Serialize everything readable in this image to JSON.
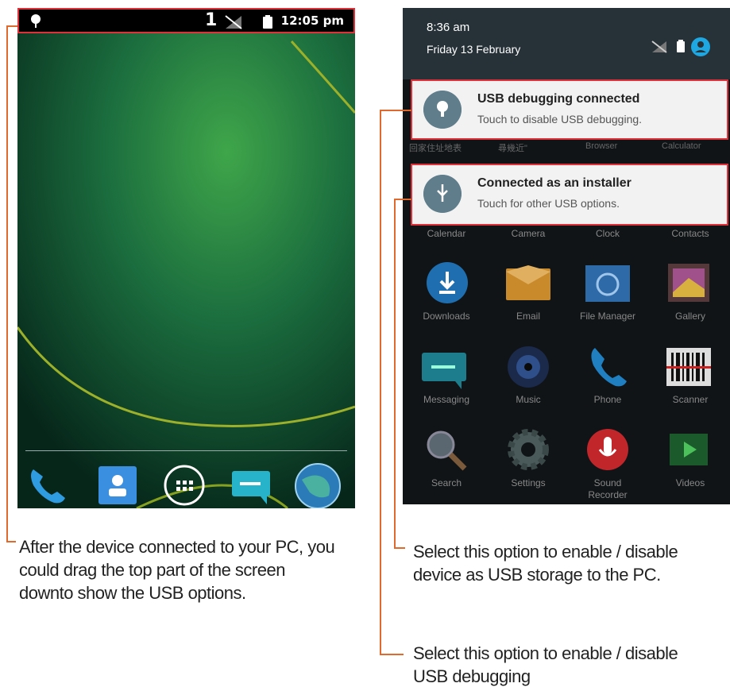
{
  "left_phone": {
    "status_count": "1",
    "time": "12:05 pm",
    "dock_icons": [
      "phone-icon",
      "contacts-icon",
      "apps-grid-icon",
      "messaging-icon",
      "browser-globe-icon"
    ]
  },
  "right_phone": {
    "header_time": "8:36 am",
    "header_date": "Friday 13 February",
    "notifications": [
      {
        "title": "USB debugging connected",
        "subtitle": "Touch to disable USB debugging."
      },
      {
        "title": "Connected as an installer",
        "subtitle": "Touch for other USB options."
      }
    ],
    "strip_labels": [
      "回家住址地表",
      "尋幾近\"",
      "Browser",
      "Calculator"
    ],
    "apps_row1": [
      "Calendar",
      "Camera",
      "Clock",
      "Contacts"
    ],
    "apps_row2": [
      "Downloads",
      "Email",
      "File Manager",
      "Gallery"
    ],
    "apps_row3": [
      "Messaging",
      "Music",
      "Phone",
      "Scanner"
    ],
    "apps_row4": [
      "Search",
      "Settings",
      "Sound\nRecorder",
      "Videos"
    ]
  },
  "captions": {
    "left": "After the device connected to your PC, you could drag the top part of the screen downto show the USB options.",
    "right_1": "Select this option to enable / disable device as USB storage to the PC.",
    "right_2": "Select this option to enable / disable USB debugging"
  },
  "colors": {
    "highlight": "#e0303a",
    "bracket": "#e06a2e",
    "notification_icon": "#607d8b"
  }
}
